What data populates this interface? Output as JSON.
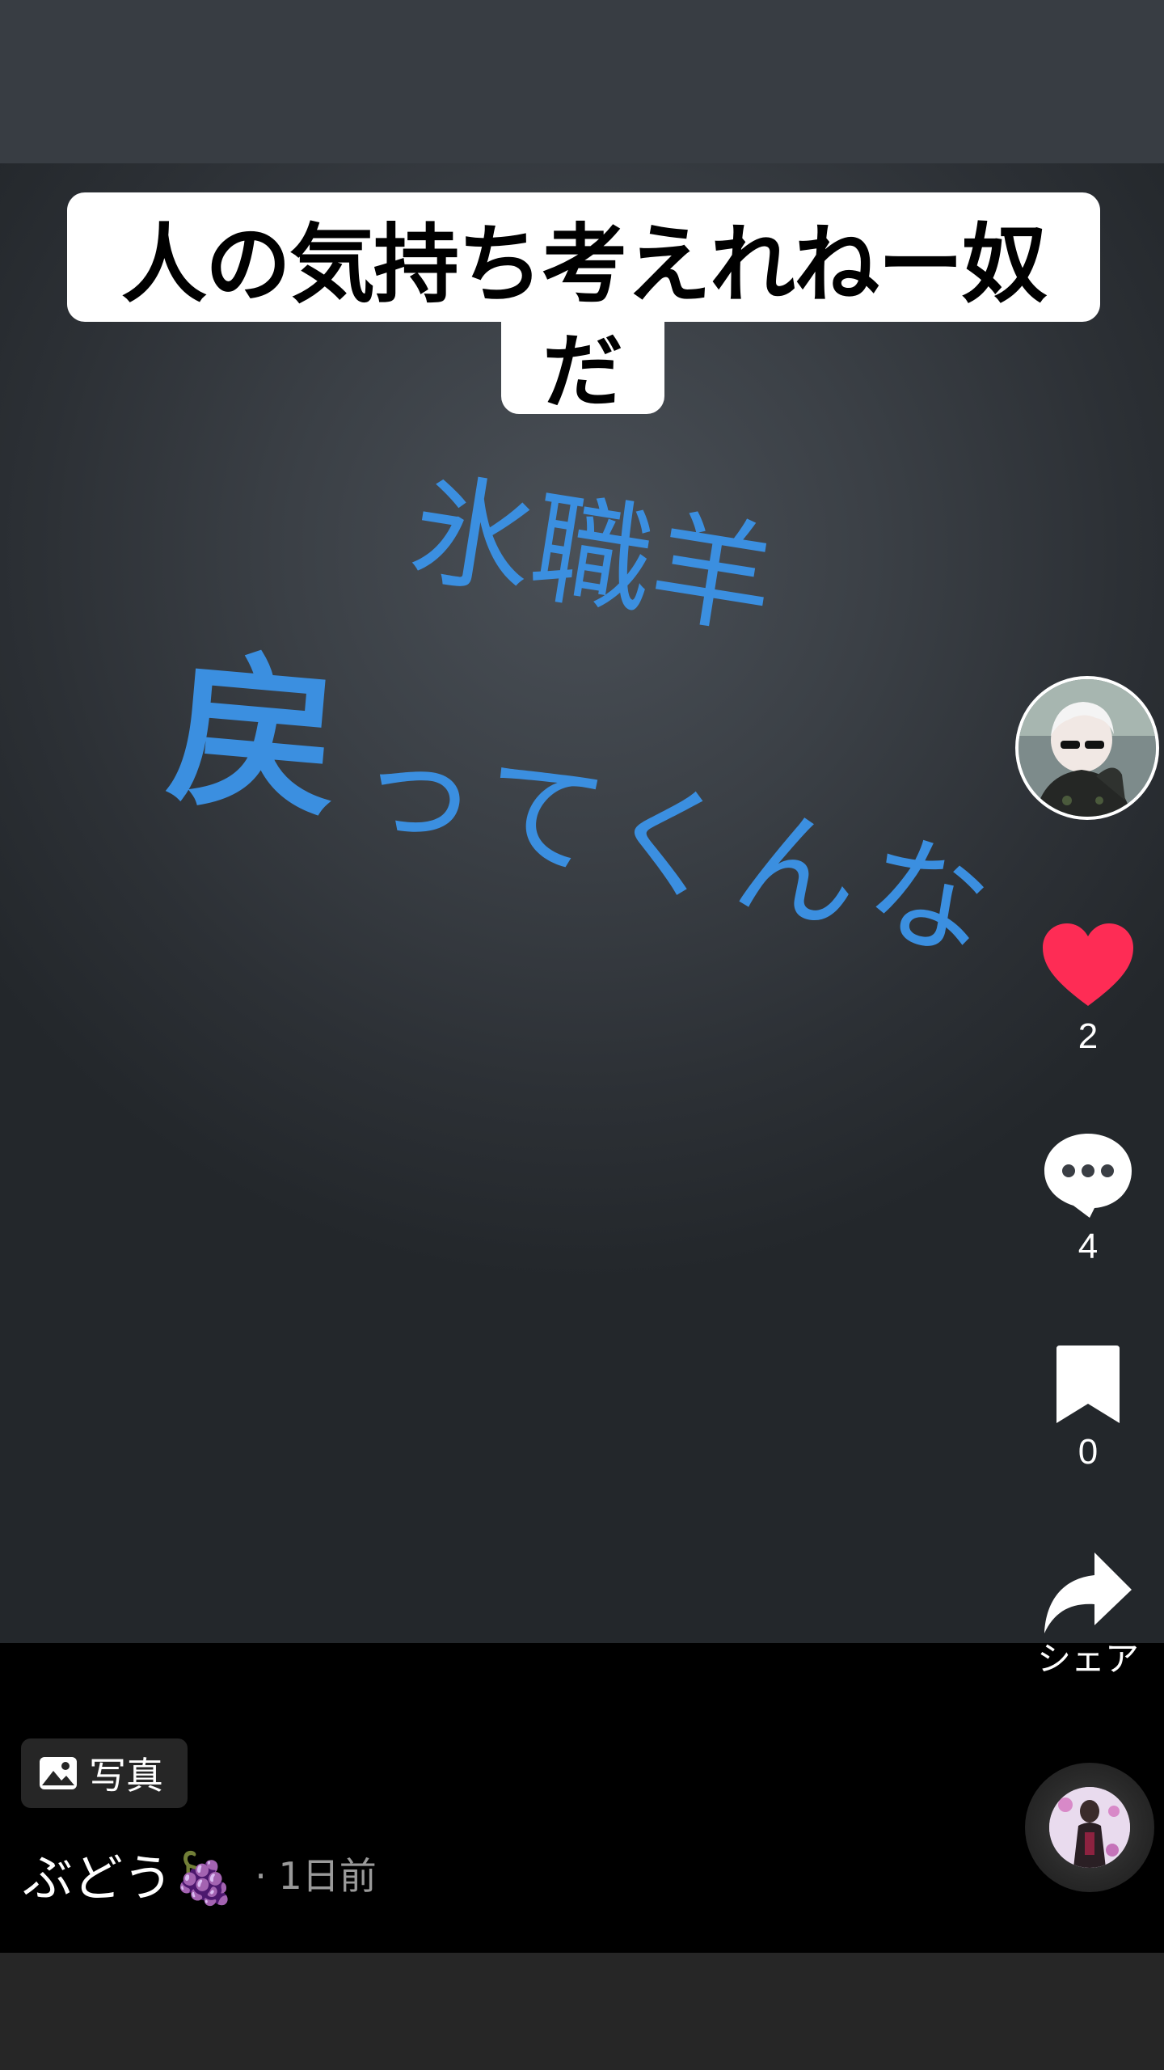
{
  "caption": {
    "line1": "人の気持ち考えれねー奴",
    "line2": "だ"
  },
  "handwriting": {
    "line1": "氷職羊",
    "line2": "戻",
    "line3": "ってくんな"
  },
  "actions": {
    "likes": "2",
    "comments": "4",
    "saves": "0",
    "share_label": "シェア"
  },
  "post": {
    "badge_label": "写真",
    "author": "ぶどう🍇",
    "time": "· 1日前"
  },
  "colors": {
    "like": "#fe2c55",
    "handwriting": "#3b8fe0"
  },
  "icons": [
    "heart-icon",
    "comment-icon",
    "bookmark-icon",
    "share-icon",
    "photo-icon"
  ]
}
